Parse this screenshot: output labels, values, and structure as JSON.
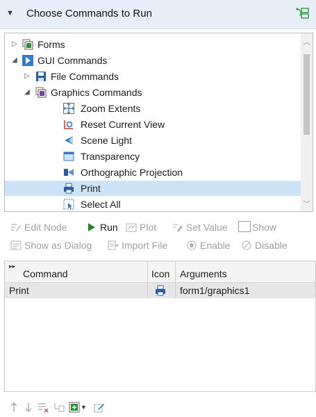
{
  "header": {
    "title": "Choose Commands to Run",
    "collapse_icon": "triangle-down-icon",
    "settings_icon": "tree-node-icon"
  },
  "tree": {
    "items": [
      {
        "label": "Forms",
        "icon": "forms-icon",
        "expander": "collapsed"
      },
      {
        "label": "GUI Commands",
        "icon": "gui-commands-icon",
        "expander": "expanded"
      },
      {
        "label": "File Commands",
        "icon": "file-commands-icon",
        "expander": "collapsed"
      },
      {
        "label": "Graphics Commands",
        "icon": "graphics-commands-icon",
        "expander": "expanded"
      },
      {
        "label": "Zoom Extents",
        "icon": "zoom-extents-icon"
      },
      {
        "label": "Reset Current View",
        "icon": "reset-view-icon"
      },
      {
        "label": "Scene Light",
        "icon": "scene-light-icon"
      },
      {
        "label": "Transparency",
        "icon": "transparency-icon"
      },
      {
        "label": "Orthographic Projection",
        "icon": "orthographic-projection-icon"
      },
      {
        "label": "Print",
        "icon": "print-icon",
        "selected": true
      },
      {
        "label": "Select All",
        "icon": "select-all-icon"
      }
    ]
  },
  "toolbar": {
    "edit_node": "Edit Node",
    "run": "Run",
    "plot": "Plot",
    "set_value": "Set Value",
    "show": "Show",
    "show_as_dialog": "Show as Dialog",
    "import_file": "Import File",
    "enable": "Enable",
    "disable": "Disable"
  },
  "table": {
    "columns": [
      "Command",
      "Icon",
      "Arguments"
    ],
    "rows": [
      {
        "command": "Print",
        "icon": "print-icon",
        "arguments": "form1/graphics1"
      }
    ]
  },
  "bottom_toolbar": {
    "icons": [
      "move-up-icon",
      "move-down-icon",
      "delete-icon",
      "clear-table-icon",
      "add-command-icon",
      "dropdown-arrow-icon",
      "edit-icon"
    ]
  },
  "colors": {
    "accent": "#2e7bc4",
    "selection": "#cde3f8",
    "run_green": "#1e8c1e",
    "header_bg": "#e7eef7"
  }
}
